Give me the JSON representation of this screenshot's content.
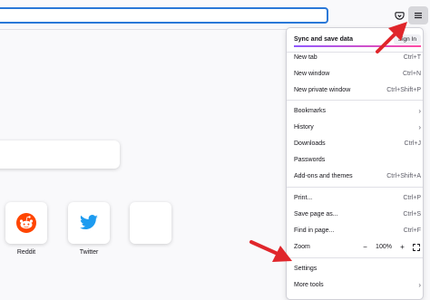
{
  "menu": {
    "sync": {
      "label": "Sync and save data",
      "signin_label": "Sign In"
    },
    "items": [
      {
        "label": "New tab",
        "shortcut": "Ctrl+T"
      },
      {
        "label": "New window",
        "shortcut": "Ctrl+N"
      },
      {
        "label": "New private window",
        "shortcut": "Ctrl+Shift+P"
      },
      {
        "label": "Bookmarks",
        "chevron": "›"
      },
      {
        "label": "History",
        "chevron": "›"
      },
      {
        "label": "Downloads",
        "shortcut": "Ctrl+J"
      },
      {
        "label": "Passwords",
        "shortcut": ""
      },
      {
        "label": "Add-ons and themes",
        "shortcut": "Ctrl+Shift+A"
      },
      {
        "label": "Print...",
        "shortcut": "Ctrl+P"
      },
      {
        "label": "Save page as...",
        "shortcut": "Ctrl+S"
      },
      {
        "label": "Find in page...",
        "shortcut": "Ctrl+F"
      },
      {
        "label": "Settings",
        "shortcut": ""
      },
      {
        "label": "More tools",
        "chevron": "›"
      }
    ],
    "zoom": {
      "label": "Zoom",
      "minus": "−",
      "value": "100%",
      "plus": "+"
    }
  },
  "shortcuts": [
    {
      "label": "Reddit",
      "icon": "reddit-icon"
    },
    {
      "label": "Twitter",
      "icon": "twitter-icon"
    }
  ],
  "colors": {
    "accent": "#2a78d8",
    "arrow": "#e0262b",
    "reddit": "#ff4500",
    "twitter": "#1d9bf0"
  }
}
